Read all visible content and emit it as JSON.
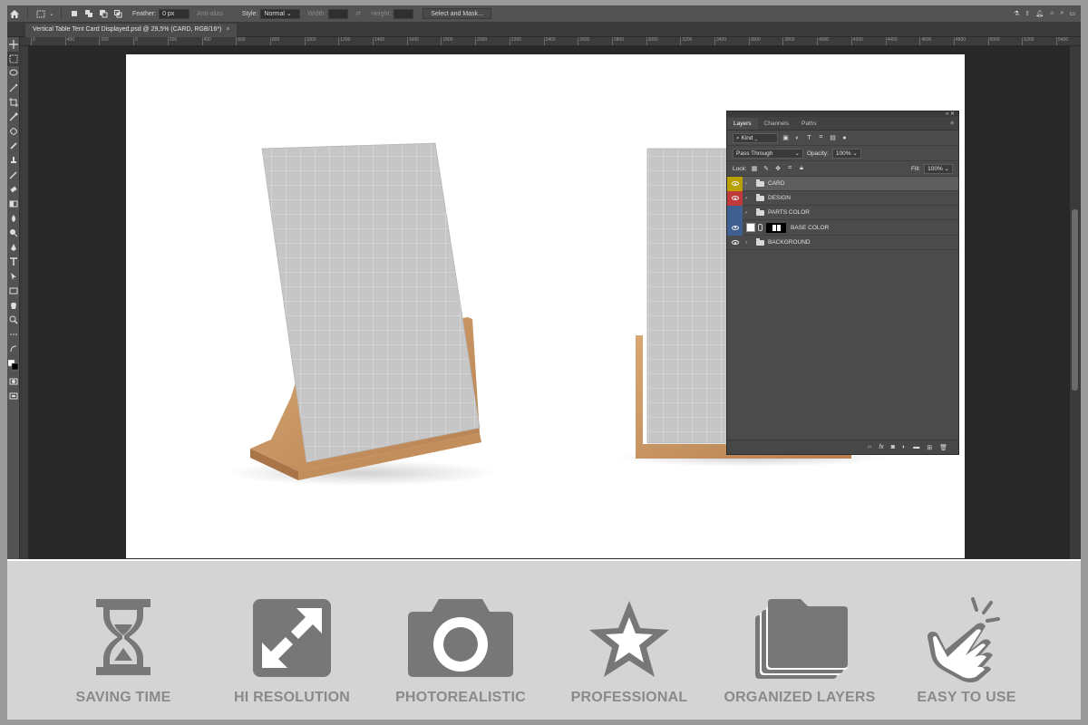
{
  "options_bar": {
    "feather_label": "Feather:",
    "feather_value": "0 px",
    "anti_alias_label": "Anti-alias",
    "style_label": "Style:",
    "style_value": "Normal",
    "width_label": "Width:",
    "height_label": "Height:",
    "select_mask_label": "Select and Mask..."
  },
  "document_tab": {
    "title": "Vertical Table Tent Card Displayed.psd @ 29,5% (CARD, RGB/16*)",
    "close": "×"
  },
  "ruler_ticks": [
    "0",
    "400",
    "200",
    "0",
    "200",
    "400",
    "600",
    "800",
    "1000",
    "1200",
    "1400",
    "1600",
    "1800",
    "2000",
    "2200",
    "2400",
    "2600",
    "2800",
    "3000",
    "3200",
    "3400",
    "3600",
    "3800",
    "4000",
    "4200",
    "4400",
    "4600",
    "4800",
    "5000",
    "5200",
    "5400"
  ],
  "layers_panel": {
    "collapse": "« ✕",
    "tabs": [
      "Layers",
      "Channels",
      "Paths"
    ],
    "menu_icon": "≡",
    "filter_kind": "Kind",
    "blend_mode": "Pass Through",
    "opacity_label": "Opacity:",
    "opacity_value": "100%",
    "lock_label": "Lock:",
    "fill_label": "Fill:",
    "fill_value": "100%",
    "layers": [
      {
        "name": "CARD",
        "color": "#b8a100",
        "type": "group",
        "visible": true,
        "selected": true
      },
      {
        "name": "DESIGN",
        "color": "#c0393b",
        "type": "group",
        "visible": true,
        "selected": false
      },
      {
        "name": "PARTS COLOR",
        "color": "#3e5f8f",
        "type": "group",
        "visible": false,
        "selected": false
      },
      {
        "name": "BASE COLOR",
        "color": "#3e5f8f",
        "type": "layer",
        "visible": true,
        "selected": false
      },
      {
        "name": "BACKGROUND",
        "color": "",
        "type": "group",
        "visible": true,
        "selected": false
      }
    ],
    "footer_icons": [
      "link-icon",
      "fx-icon",
      "mask-icon",
      "adjustment-icon",
      "folder-icon",
      "new-layer-icon",
      "trash-icon"
    ]
  },
  "features": [
    {
      "label": "SAVING TIME",
      "icon": "hourglass-icon"
    },
    {
      "label": "HI RESOLUTION",
      "icon": "expand-icon"
    },
    {
      "label": "PHOTOREALISTIC",
      "icon": "camera-icon"
    },
    {
      "label": "PROFESSIONAL",
      "icon": "star-icon"
    },
    {
      "label": "ORGANIZED LAYERS",
      "icon": "layers-icon"
    },
    {
      "label": "EASY TO USE",
      "icon": "tap-hand-icon"
    }
  ],
  "colors": {
    "feature_gray": "#777777",
    "label_gray": "#8a8a8a",
    "wood": "#c99a6a",
    "card_gray": "#c4c4c4"
  }
}
